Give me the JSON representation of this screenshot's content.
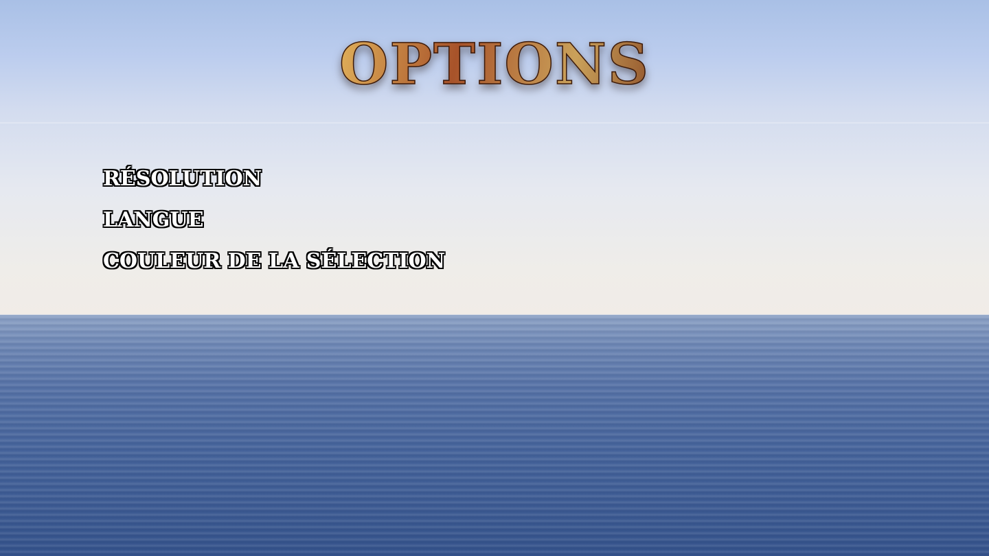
{
  "title": "OPTIONS",
  "menu": {
    "items": [
      {
        "label": "RÉSOLUTION"
      },
      {
        "label": "LANGUE"
      },
      {
        "label": "COULEUR DE LA SÉLECTION"
      }
    ]
  },
  "colors": {
    "sky_top": "#a9c0e6",
    "sky_bottom": "#f1ece7",
    "sea": "#46649b",
    "title_rust": "#b56a2a",
    "menu_text": "#ffffff",
    "menu_outline": "#000000"
  }
}
